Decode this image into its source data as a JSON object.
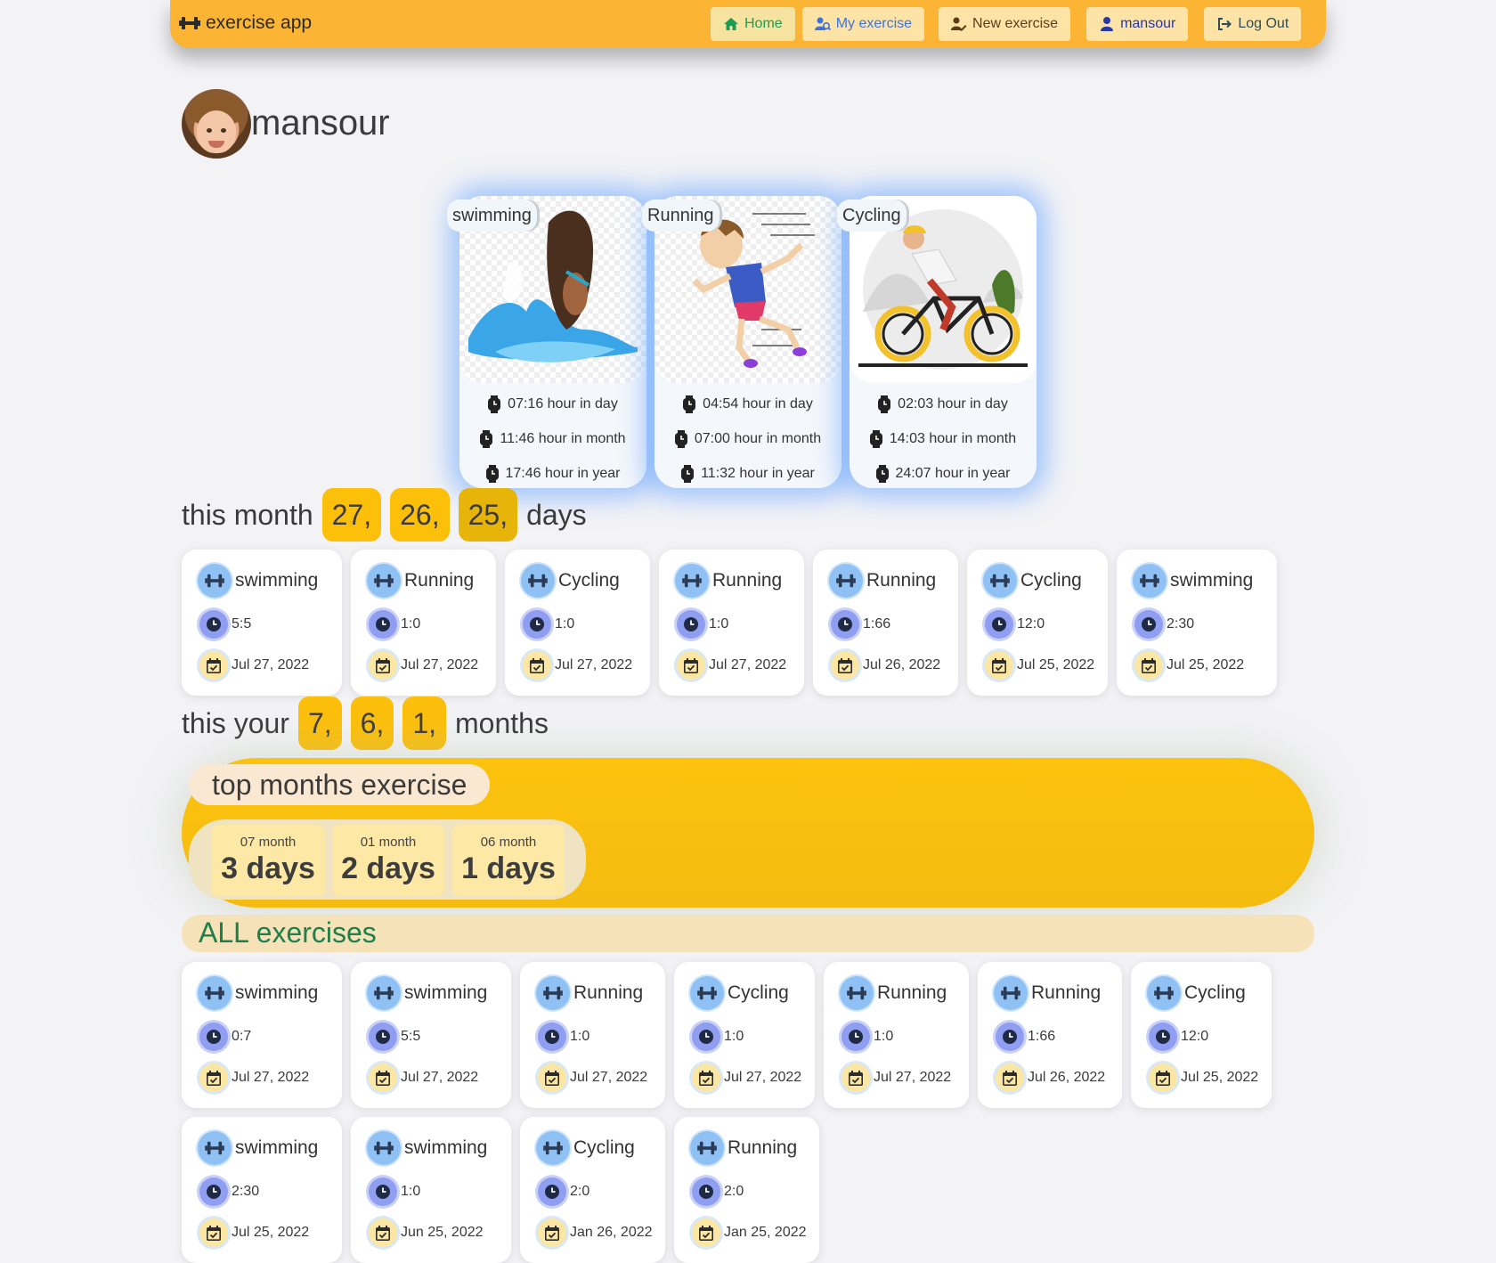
{
  "navbar": {
    "brand": "exercise app",
    "links": [
      {
        "label": "Home",
        "icon": "home-icon"
      },
      {
        "label": "My exercise",
        "icon": "user-group-icon"
      },
      {
        "label": "New exercise",
        "icon": "user-edit-icon"
      },
      {
        "label": "mansour",
        "icon": "user-icon"
      },
      {
        "label": "Log Out",
        "icon": "logout-icon"
      }
    ]
  },
  "profile": {
    "name": "mansour"
  },
  "activities": [
    {
      "name": "swimming",
      "day": "07:16 hour in day",
      "month": "11:46 hour in month",
      "year": "17:46 hour in year"
    },
    {
      "name": "Running",
      "day": "04:54 hour in day",
      "month": "07:00 hour in month",
      "year": "11:32 hour in year"
    },
    {
      "name": "Cycling",
      "day": "02:03 hour in day",
      "month": "14:03 hour in month",
      "year": "24:07 hour in year"
    }
  ],
  "this_month": {
    "label": "this month",
    "days": [
      "27,",
      "26,",
      "25,"
    ],
    "suffix": "days",
    "exercises": [
      {
        "name": "swimming",
        "time": "5:5",
        "date": "Jul 27, 2022"
      },
      {
        "name": "Running",
        "time": "1:0",
        "date": "Jul 27, 2022"
      },
      {
        "name": "Cycling",
        "time": "1:0",
        "date": "Jul 27, 2022"
      },
      {
        "name": "Running",
        "time": "1:0",
        "date": "Jul 27, 2022"
      },
      {
        "name": "Running",
        "time": "1:66",
        "date": "Jul 26, 2022"
      },
      {
        "name": "Cycling",
        "time": "12:0",
        "date": "Jul 25, 2022"
      },
      {
        "name": "swimming",
        "time": "2:30",
        "date": "Jul 25, 2022"
      }
    ]
  },
  "this_year": {
    "label": "this your",
    "months": [
      "7,",
      "6,",
      "1,"
    ],
    "suffix": "months"
  },
  "top_months": {
    "title": "top months exercise",
    "items": [
      {
        "label": "07 month",
        "value": "3 days"
      },
      {
        "label": "01 month",
        "value": "2 days"
      },
      {
        "label": "06 month",
        "value": "1 days"
      }
    ]
  },
  "all_exercises": {
    "title": "ALL exercises",
    "rows": [
      [
        {
          "name": "swimming",
          "time": "0:7",
          "date": "Jul 27, 2022"
        },
        {
          "name": "swimming",
          "time": "5:5",
          "date": "Jul 27, 2022"
        },
        {
          "name": "Running",
          "time": "1:0",
          "date": "Jul 27, 2022"
        },
        {
          "name": "Cycling",
          "time": "1:0",
          "date": "Jul 27, 2022"
        },
        {
          "name": "Running",
          "time": "1:0",
          "date": "Jul 27, 2022"
        },
        {
          "name": "Running",
          "time": "1:66",
          "date": "Jul 26, 2022"
        },
        {
          "name": "Cycling",
          "time": "12:0",
          "date": "Jul 25, 2022"
        }
      ],
      [
        {
          "name": "swimming",
          "time": "2:30",
          "date": "Jul 25, 2022"
        },
        {
          "name": "swimming",
          "time": "1:0",
          "date": "Jun 25, 2022"
        },
        {
          "name": "Cycling",
          "time": "2:0",
          "date": "Jan 26, 2022"
        },
        {
          "name": "Running",
          "time": "2:0",
          "date": "Jan 25, 2022"
        }
      ]
    ]
  },
  "colors": {
    "navbar": "#fbb434",
    "accent_yellow": "#fcbf0a",
    "all_title_green": "#1e7f4a",
    "card_glow": "#5fa0ff"
  }
}
